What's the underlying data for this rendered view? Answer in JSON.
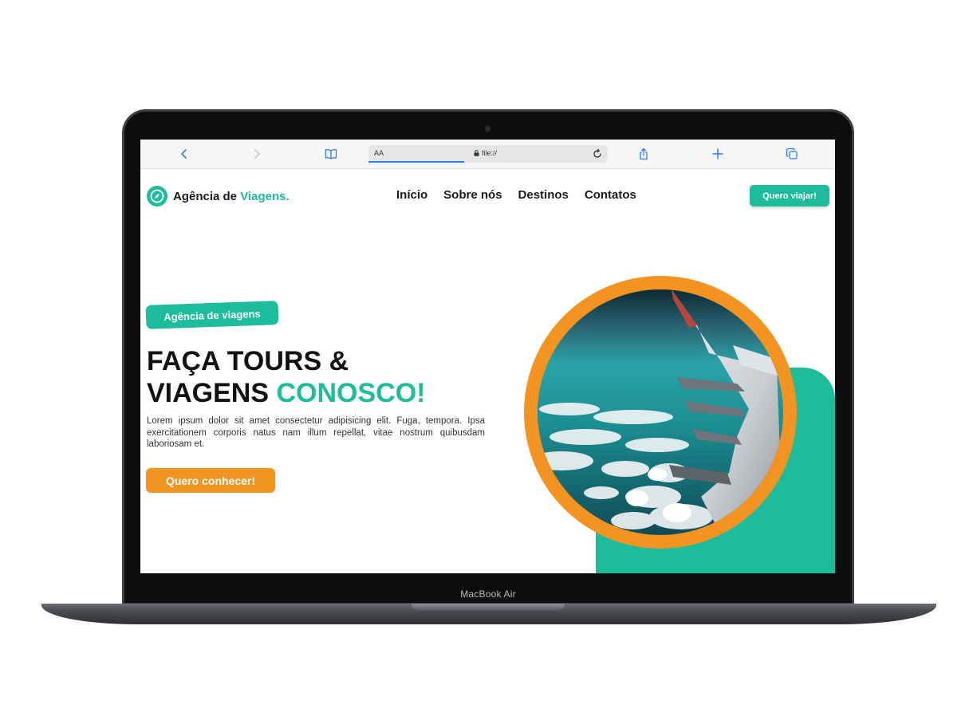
{
  "device": {
    "label": "MacBook Air"
  },
  "browser": {
    "reader_label": "AA",
    "url": "file://",
    "icons": [
      "back-icon",
      "forward-icon",
      "bookmarks-icon",
      "lock-icon",
      "reload-icon",
      "share-icon",
      "new-tab-icon",
      "tabs-icon"
    ]
  },
  "site": {
    "logo": {
      "prefix": "Agência de",
      "accent": "Viagens."
    },
    "nav": [
      "Início",
      "Sobre nós",
      "Destinos",
      "Contatos"
    ],
    "cta_top": "Quero viajar!",
    "hero": {
      "badge": "Agência de viagens",
      "headline_line1": "FAÇA TOURS &",
      "headline_line2_plain": "VIAGENS",
      "headline_line2_accent": "CONOSCO!",
      "lead": "Lorem ipsum dolor sit amet consectetur adipisicing elit. Fuga, tempora. Ipsa exercitationem corporis natus nam illum repellat, vitae nostrum quibusdam laboriosam et.",
      "cta": "Quero conhecer!",
      "image_subject": "airplane wing over clouds"
    }
  },
  "colors": {
    "accent": "#1dbc9a",
    "orange": "#f29422",
    "link": "#2f7cf6",
    "text": "#111111"
  }
}
